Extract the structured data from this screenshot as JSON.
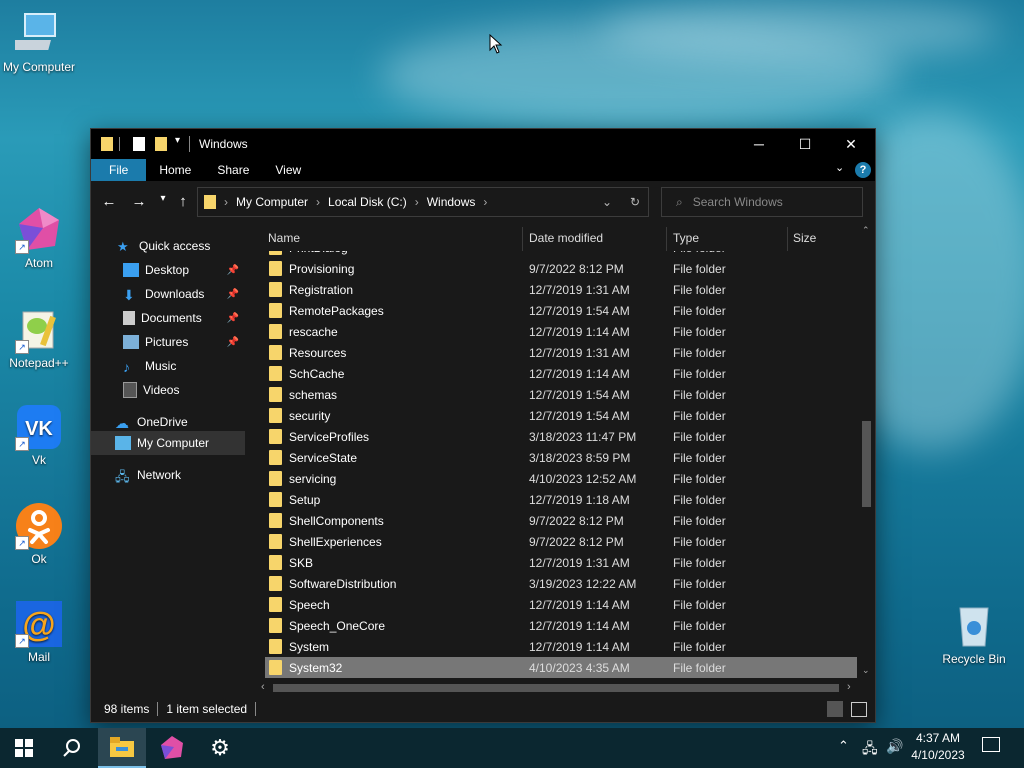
{
  "desktop": {
    "icons": [
      {
        "label": "My Computer"
      },
      {
        "label": "Atom"
      },
      {
        "label": "Notepad++"
      },
      {
        "label": "Vk"
      },
      {
        "label": "Ok"
      },
      {
        "label": "Mail"
      },
      {
        "label": "Recycle Bin"
      }
    ]
  },
  "window": {
    "title": "Windows",
    "ribbon_tabs": [
      "File",
      "Home",
      "Share",
      "View"
    ],
    "breadcrumb": [
      "My Computer",
      "Local Disk (C:)",
      "Windows"
    ],
    "search_placeholder": "Search Windows",
    "nav_pane": {
      "quick_access": "Quick access",
      "items": [
        "Desktop",
        "Downloads",
        "Documents",
        "Pictures",
        "Music",
        "Videos"
      ],
      "onedrive": "OneDrive",
      "my_computer": "My Computer",
      "network": "Network"
    },
    "columns": [
      "Name",
      "Date modified",
      "Type",
      "Size"
    ],
    "partial_row": {
      "name": "PrintDialog",
      "type": "File folder"
    },
    "rows": [
      {
        "name": "Provisioning",
        "date": "9/7/2022 8:12 PM",
        "type": "File folder"
      },
      {
        "name": "Registration",
        "date": "12/7/2019 1:31 AM",
        "type": "File folder"
      },
      {
        "name": "RemotePackages",
        "date": "12/7/2019 1:54 AM",
        "type": "File folder"
      },
      {
        "name": "rescache",
        "date": "12/7/2019 1:14 AM",
        "type": "File folder"
      },
      {
        "name": "Resources",
        "date": "12/7/2019 1:31 AM",
        "type": "File folder"
      },
      {
        "name": "SchCache",
        "date": "12/7/2019 1:14 AM",
        "type": "File folder"
      },
      {
        "name": "schemas",
        "date": "12/7/2019 1:54 AM",
        "type": "File folder"
      },
      {
        "name": "security",
        "date": "12/7/2019 1:54 AM",
        "type": "File folder"
      },
      {
        "name": "ServiceProfiles",
        "date": "3/18/2023 11:47 PM",
        "type": "File folder"
      },
      {
        "name": "ServiceState",
        "date": "3/18/2023 8:59 PM",
        "type": "File folder"
      },
      {
        "name": "servicing",
        "date": "4/10/2023 12:52 AM",
        "type": "File folder"
      },
      {
        "name": "Setup",
        "date": "12/7/2019 1:18 AM",
        "type": "File folder"
      },
      {
        "name": "ShellComponents",
        "date": "9/7/2022 8:12 PM",
        "type": "File folder"
      },
      {
        "name": "ShellExperiences",
        "date": "9/7/2022 8:12 PM",
        "type": "File folder"
      },
      {
        "name": "SKB",
        "date": "12/7/2019 1:31 AM",
        "type": "File folder"
      },
      {
        "name": "SoftwareDistribution",
        "date": "3/19/2023 12:22 AM",
        "type": "File folder"
      },
      {
        "name": "Speech",
        "date": "12/7/2019 1:14 AM",
        "type": "File folder"
      },
      {
        "name": "Speech_OneCore",
        "date": "12/7/2019 1:14 AM",
        "type": "File folder"
      },
      {
        "name": "System",
        "date": "12/7/2019 1:14 AM",
        "type": "File folder"
      },
      {
        "name": "System32",
        "date": "4/10/2023 4:35 AM",
        "type": "File folder",
        "selected": true
      }
    ],
    "status": {
      "items": "98 items",
      "selected": "1 item selected"
    }
  },
  "taskbar": {
    "time": "4:37 AM",
    "date": "4/10/2023"
  },
  "colors": {
    "accent": "#1b7bac",
    "folder": "#f7d56b",
    "selection": "#777777"
  }
}
